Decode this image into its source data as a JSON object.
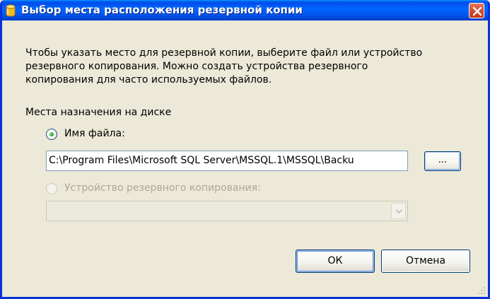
{
  "window": {
    "title": "Выбор места расположения резервной копии",
    "icon": "database-icon",
    "accent_color": "#0054e3",
    "close_button_color": "#d65032"
  },
  "description": {
    "line1": "Чтобы указать место для резервной копии, выберите файл или устройство",
    "line2": "резервного копирования. Можно создать устройства резервного",
    "line3": "копирования для часто используемых файлов."
  },
  "destination": {
    "section_label": "Места назначения на диске",
    "file_option": {
      "label": "Имя файла:",
      "selected": true
    },
    "file_path": "C:\\Program Files\\Microsoft SQL Server\\MSSQL.1\\MSSQL\\Backu",
    "browse_label": "...",
    "device_option": {
      "label": "Устройство резервного копирования:",
      "selected": false,
      "disabled": true
    },
    "device_value": ""
  },
  "buttons": {
    "ok_label": "ОК",
    "cancel_label": "Отмена"
  }
}
